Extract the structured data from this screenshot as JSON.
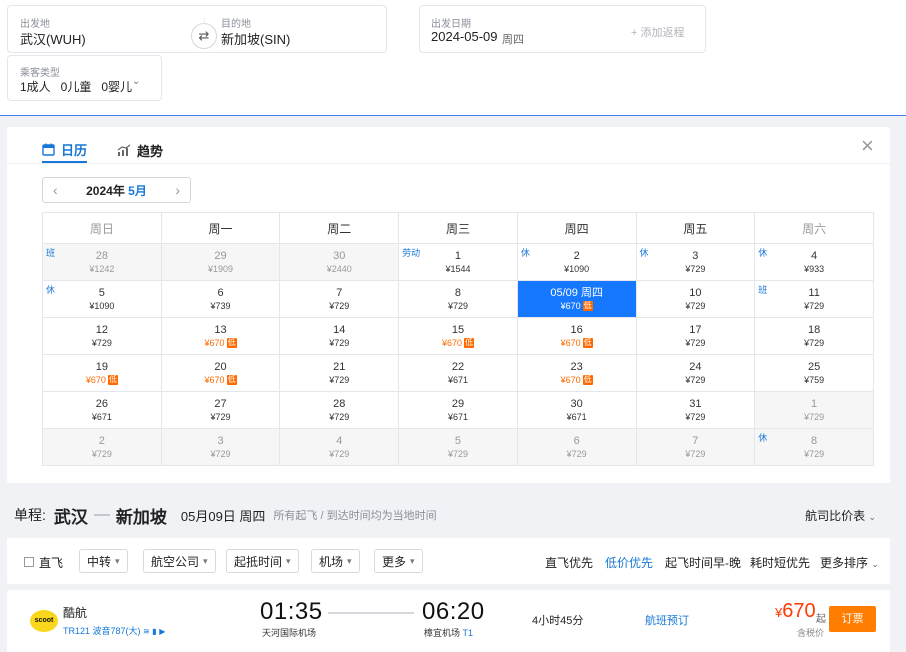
{
  "search": {
    "origin_label": "出发地",
    "origin_value": "武汉(WUH)",
    "dest_label": "目的地",
    "dest_value": "新加坡(SIN)",
    "date_label": "出发日期",
    "date_value": "2024-05-09",
    "date_weekday": "周四",
    "add_return": "+ 添加返程",
    "pax_label": "乘客类型",
    "pax_value": "1成人   0儿童   0婴儿"
  },
  "calendar": {
    "tab_calendar": "日历",
    "tab_trend": "趋势",
    "year_label": "2024年",
    "month_label": "5月",
    "weekdays": [
      "周日",
      "周一",
      "周二",
      "周三",
      "周四",
      "周五",
      "周六"
    ],
    "weeks": [
      [
        {
          "d": "28",
          "p": "¥1242",
          "out": true,
          "tag": "班"
        },
        {
          "d": "29",
          "p": "¥1909",
          "out": true
        },
        {
          "d": "30",
          "p": "¥2440",
          "out": true
        },
        {
          "d": "1",
          "p": "¥1544",
          "tag": "劳动"
        },
        {
          "d": "2",
          "p": "¥1090",
          "tag": "休"
        },
        {
          "d": "3",
          "p": "¥729",
          "tag": "休"
        },
        {
          "d": "4",
          "p": "¥933",
          "tag": "休"
        }
      ],
      [
        {
          "d": "5",
          "p": "¥1090",
          "tag": "休"
        },
        {
          "d": "6",
          "p": "¥739"
        },
        {
          "d": "7",
          "p": "¥729"
        },
        {
          "d": "8",
          "p": "¥729"
        },
        {
          "d": "05/09 周四",
          "p": "¥670",
          "low": true,
          "sel": true
        },
        {
          "d": "10",
          "p": "¥729"
        },
        {
          "d": "11",
          "p": "¥729",
          "tag": "班"
        }
      ],
      [
        {
          "d": "12",
          "p": "¥729"
        },
        {
          "d": "13",
          "p": "¥670",
          "low": true
        },
        {
          "d": "14",
          "p": "¥729"
        },
        {
          "d": "15",
          "p": "¥670",
          "low": true
        },
        {
          "d": "16",
          "p": "¥670",
          "low": true
        },
        {
          "d": "17",
          "p": "¥729"
        },
        {
          "d": "18",
          "p": "¥729"
        }
      ],
      [
        {
          "d": "19",
          "p": "¥670",
          "low": true
        },
        {
          "d": "20",
          "p": "¥670",
          "low": true
        },
        {
          "d": "21",
          "p": "¥729"
        },
        {
          "d": "22",
          "p": "¥671"
        },
        {
          "d": "23",
          "p": "¥670",
          "low": true
        },
        {
          "d": "24",
          "p": "¥729"
        },
        {
          "d": "25",
          "p": "¥759"
        }
      ],
      [
        {
          "d": "26",
          "p": "¥671"
        },
        {
          "d": "27",
          "p": "¥729"
        },
        {
          "d": "28",
          "p": "¥729"
        },
        {
          "d": "29",
          "p": "¥671"
        },
        {
          "d": "30",
          "p": "¥671"
        },
        {
          "d": "31",
          "p": "¥729"
        },
        {
          "d": "1",
          "p": "¥729",
          "out": true
        }
      ],
      [
        {
          "d": "2",
          "p": "¥729",
          "out": true
        },
        {
          "d": "3",
          "p": "¥729",
          "out": true
        },
        {
          "d": "4",
          "p": "¥729",
          "out": true
        },
        {
          "d": "5",
          "p": "¥729",
          "out": true
        },
        {
          "d": "6",
          "p": "¥729",
          "out": true
        },
        {
          "d": "7",
          "p": "¥729",
          "out": true
        },
        {
          "d": "8",
          "p": "¥729",
          "out": true,
          "tag": "休"
        }
      ]
    ],
    "low_tag": "低"
  },
  "route": {
    "prefix": "单程:",
    "from": "武汉",
    "to": "新加坡",
    "date": "05月09日 周四",
    "note": "所有起飞 / 到达时间均为当地时间",
    "compare": "航司比价表"
  },
  "filters": {
    "direct": "直飞",
    "buttons": [
      "中转",
      "航空公司",
      "起抵时间",
      "机场",
      "更多"
    ],
    "sorts": [
      "直飞优先",
      "低价优先",
      "起飞时间早-晚",
      "耗时短优先",
      "更多排序"
    ]
  },
  "flight": {
    "logo": "scoot",
    "airline": "酷航",
    "number": "TR121 波音787(大)",
    "dep_time": "01:35",
    "dep_airport": "天河国际机场",
    "arr_time": "06:20",
    "arr_airport": "樟宜机场",
    "arr_terminal": "T1",
    "duration": "4小时45分",
    "option": "航班预订",
    "price_currency": "¥",
    "price": "670",
    "price_suffix": "起",
    "tax_note": "含税价",
    "book": "订票"
  },
  "colors": {
    "accent": "#1677d6",
    "selected": "#1677ff",
    "low": "#ff6a00",
    "price": "#ff3c00",
    "book": "#ff7d00"
  }
}
